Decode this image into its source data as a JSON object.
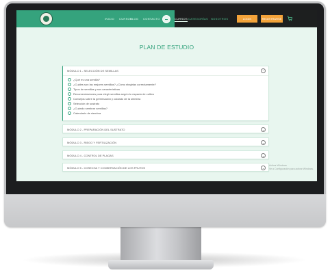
{
  "nav": {
    "links": [
      "INICIO",
      "CURSOS",
      "BLOG",
      "CONTACTO"
    ],
    "links_right": [
      "CURSOS",
      "CATEGORÍAS",
      "NOSOTROS"
    ],
    "login_label": "LOGIN",
    "register_label": "REGISTRARSE"
  },
  "page": {
    "title": "PLAN DE ESTUDIO"
  },
  "modules": [
    {
      "label": "MÓDULO 1 - SELECCIÓN DE SEMILLAS",
      "lessons": [
        "¿Qué es una semilla?",
        "¿Cuáles son las mejores semillas? ¿Cómo elegirlas correctamente?",
        "Tipos de semillas y sus características",
        "Recomendaciones para elegir semillas según tu espacio de cultivo",
        "Consejos sobre la germinación y cuidado de la siembra",
        "Selección de sustrato",
        "¿Cuándo sembrar semillas?",
        "Calendario de siembra"
      ]
    },
    {
      "label": "MÓDULO 2 - PREPARACIÓN DEL SUSTRATO"
    },
    {
      "label": "MÓDULO 3 - RIEGO Y FERTILIZACIÓN"
    },
    {
      "label": "MÓDULO 4 - CONTROL DE PLAGAS"
    },
    {
      "label": "MÓDULO 5 - COSECHA Y CONSERVACIÓN DE LOS FRUTOS"
    }
  ],
  "side_note": {
    "line1": "Activar Windows",
    "line2": "Ve a Configuración para activar Windows."
  },
  "icons": {
    "logo": "logo-icon",
    "cart": "cart-icon",
    "chevron": "chevron-down-icon",
    "lesson_bullet": "check-circle-icon",
    "mode_toggle": "toggle-icon"
  },
  "colors": {
    "brand": "#35a37d",
    "nav_dark": "#1d1f1f",
    "accent_button": "#f3a33a",
    "background": "#e8f6ef"
  }
}
